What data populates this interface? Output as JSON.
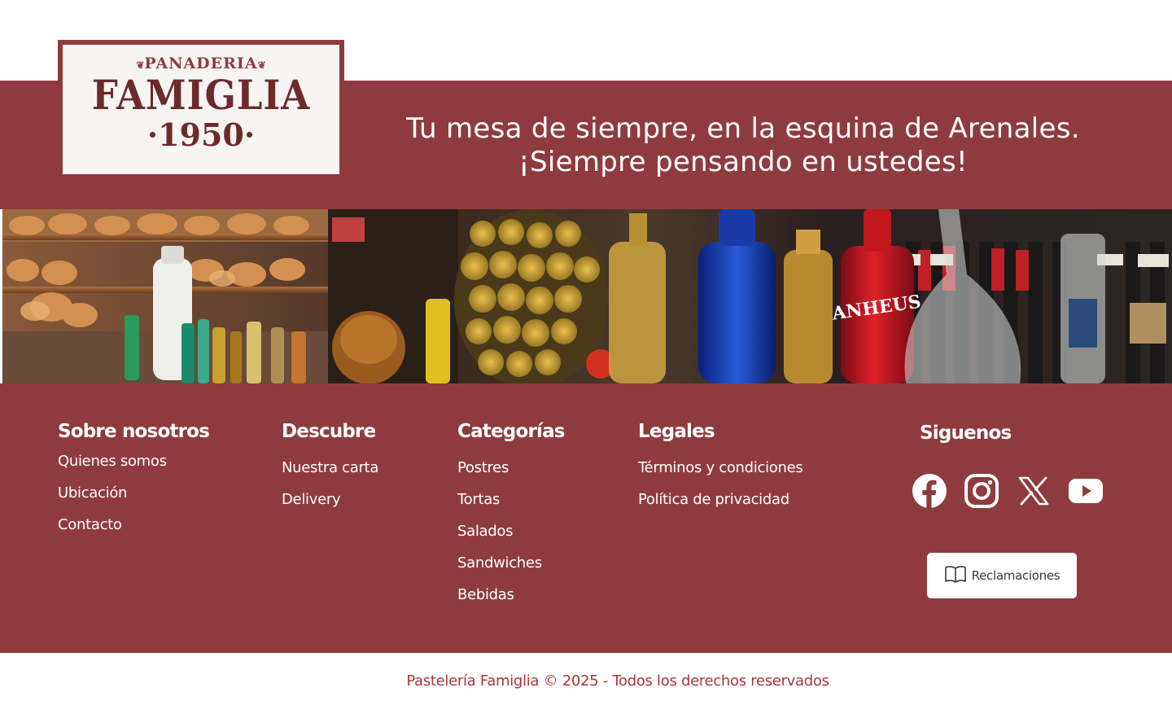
{
  "brand": {
    "top": "PANADERIA",
    "name": "FAMIGLIA",
    "year": "·1950·"
  },
  "tagline": {
    "line1": "Tu mesa de siempre, en la esquina de Arenales.",
    "line2": "¡Siempre pensando en ustedes!"
  },
  "banner_photo": {
    "bottle_label": "ANHEUS"
  },
  "footer": {
    "about": {
      "title": "Sobre nosotros",
      "links": [
        "Quienes somos",
        "Ubicación",
        "Contacto"
      ]
    },
    "discover": {
      "title": "Descubre",
      "links": [
        "Nuestra carta",
        "Delivery"
      ]
    },
    "categories": {
      "title": "Categorías",
      "links": [
        "Postres",
        "Tortas",
        "Salados",
        "Sandwiches",
        "Bebidas"
      ]
    },
    "legal": {
      "title": "Legales",
      "links": [
        "Términos y condiciones",
        "Política de privacidad"
      ]
    },
    "follow": {
      "title": "Siguenos",
      "icons": [
        "facebook-icon",
        "instagram-icon",
        "x-icon",
        "youtube-icon"
      ]
    },
    "claims_label": "Reclamaciones"
  },
  "copyright": "Pastelería Famiglia © 2025 - Todos los derechos reservados",
  "colors": {
    "brand": "#8f3b3d",
    "copyright": "#a8363b",
    "white": "#ffffff"
  }
}
